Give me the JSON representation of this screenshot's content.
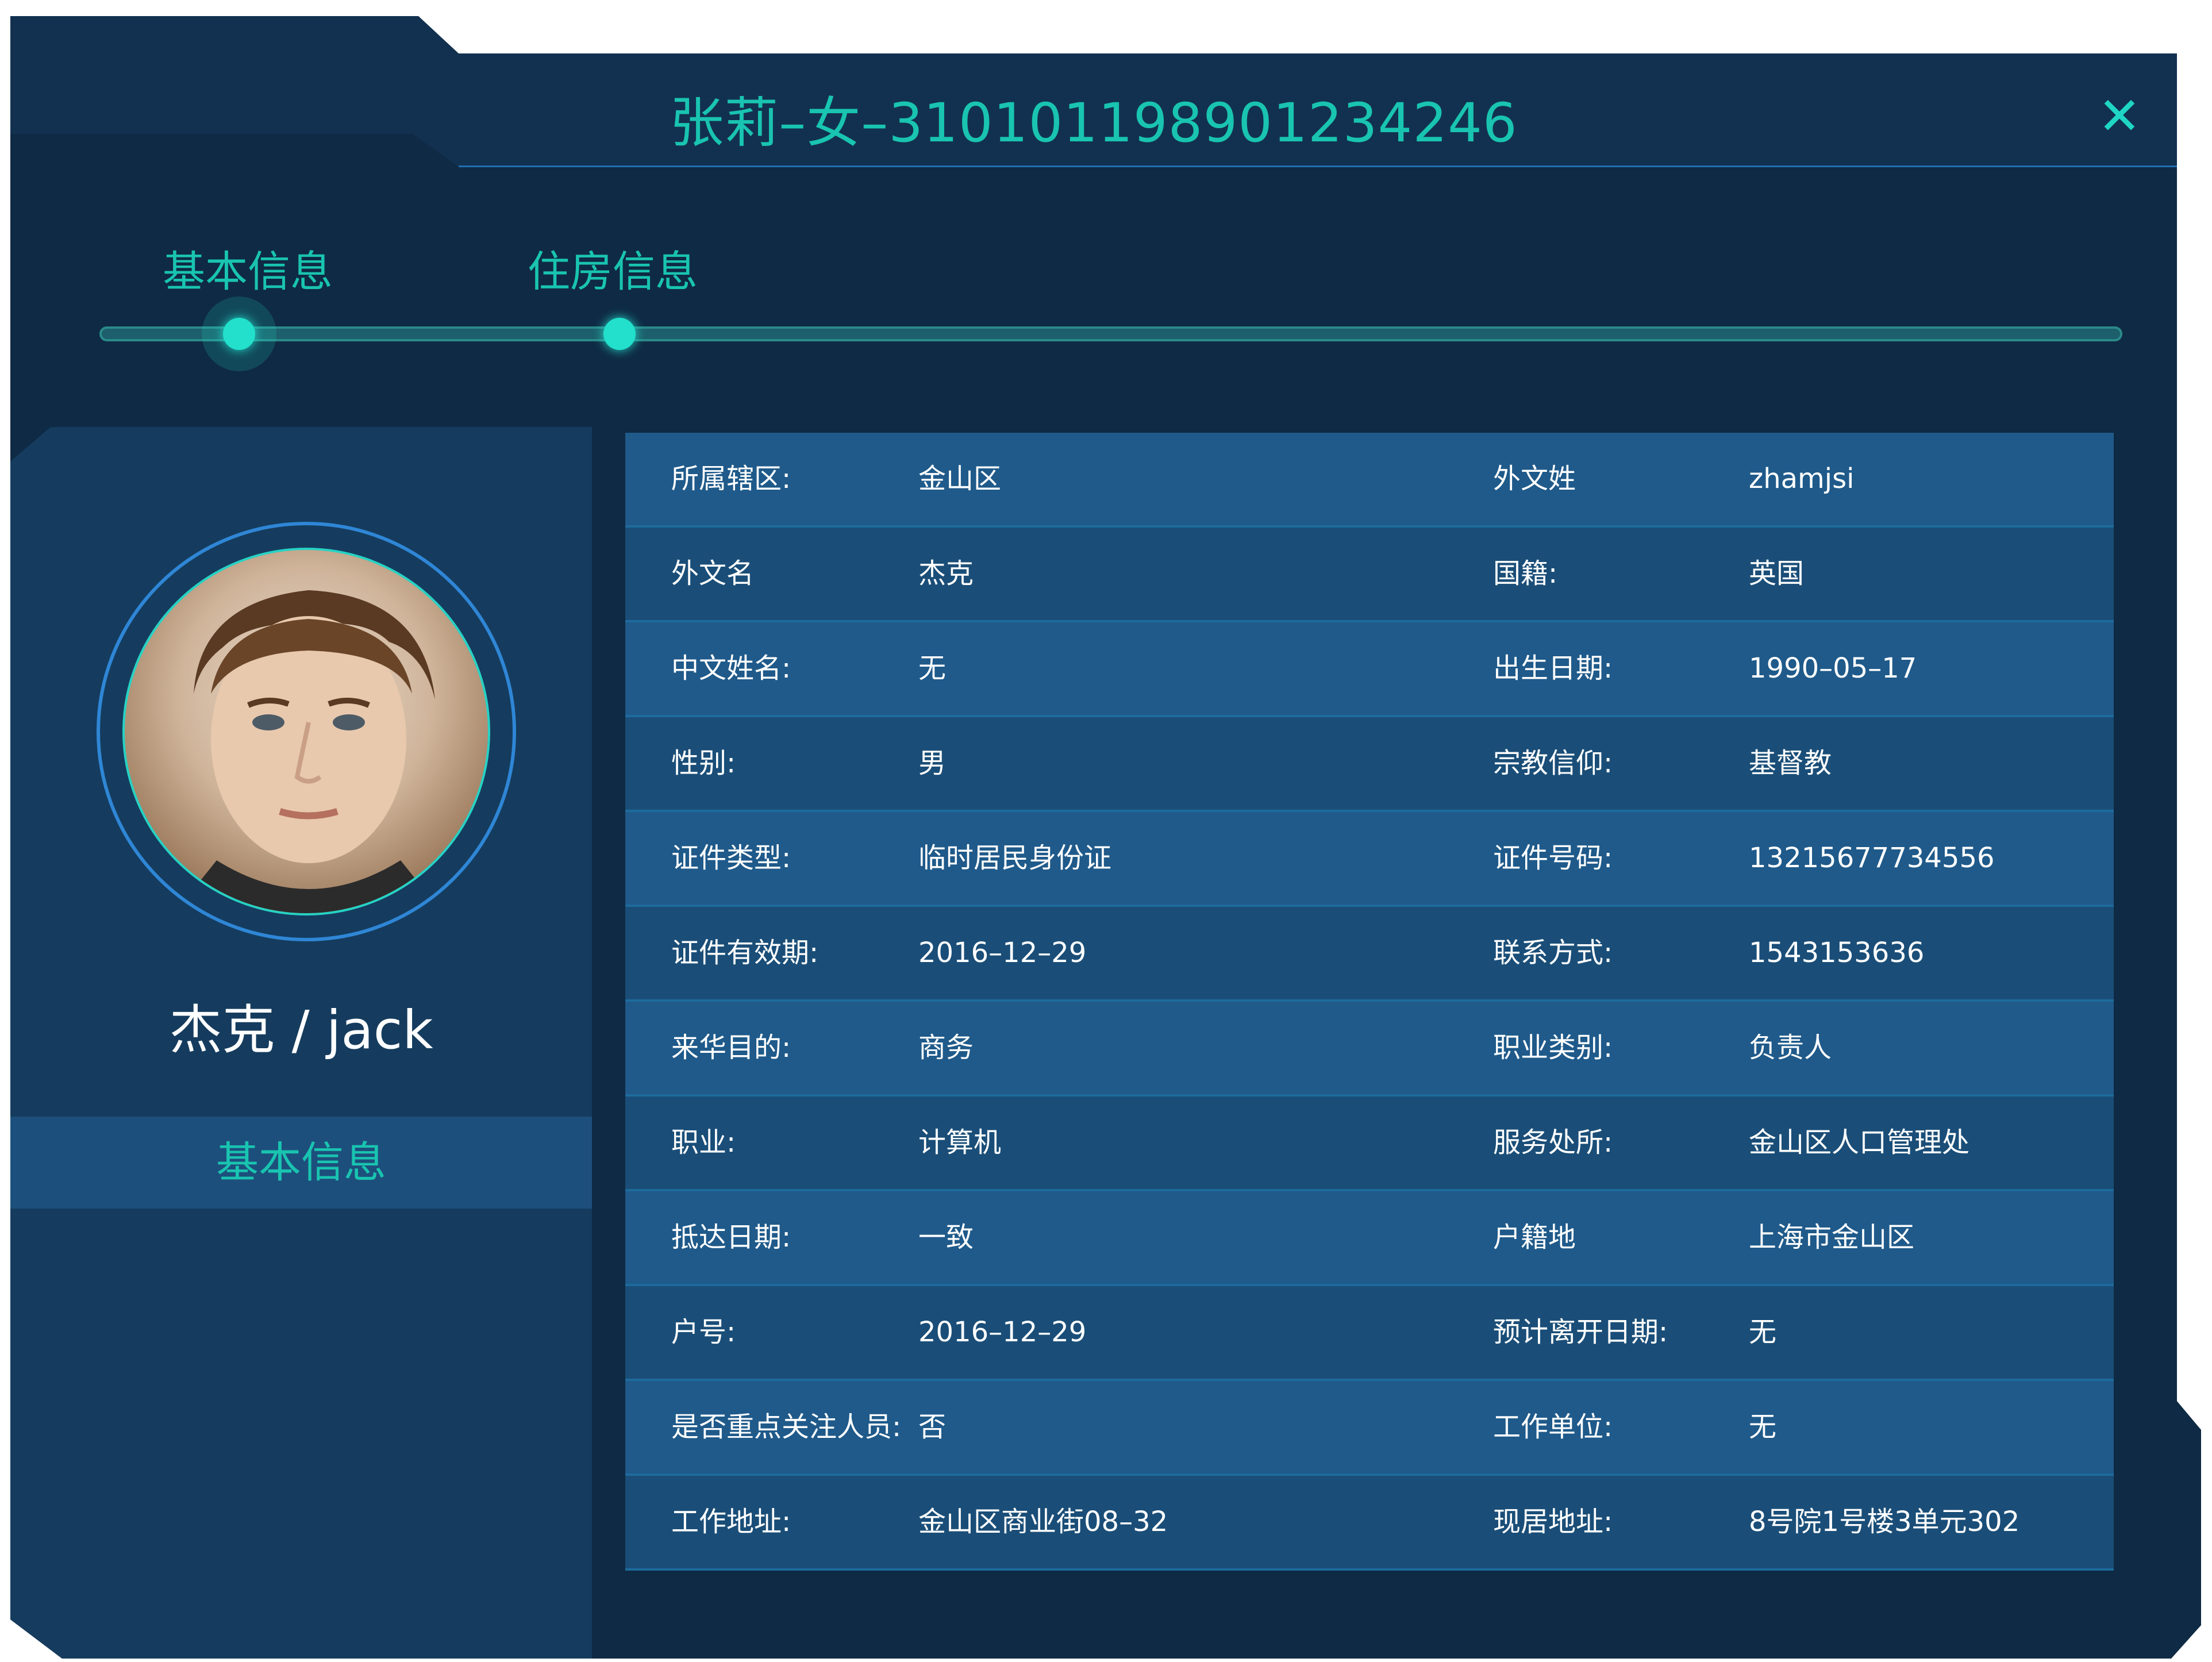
{
  "dialog": {
    "title": "张莉–女–310101198901234246"
  },
  "tabs": [
    {
      "label": "基本信息"
    },
    {
      "label": "住房信息"
    }
  ],
  "profile": {
    "name": "杰克 / jack",
    "section_tab": "基本信息"
  },
  "details": [
    {
      "label1": "所属辖区:",
      "value1": "金山区",
      "label2": "外文姓",
      "value2": "zhamjsi"
    },
    {
      "label1": "外文名",
      "value1": "杰克",
      "label2": "国籍:",
      "value2": "英国"
    },
    {
      "label1": "中文姓名:",
      "value1": "无",
      "label2": "出生日期:",
      "value2": "1990–05–17"
    },
    {
      "label1": "性别:",
      "value1": "男",
      "label2": "宗教信仰:",
      "value2": "基督教"
    },
    {
      "label1": "证件类型:",
      "value1": "临时居民身份证",
      "label2": "证件号码:",
      "value2": "13215677734556"
    },
    {
      "label1": "证件有效期:",
      "value1": "2016–12–29",
      "label2": "联系方式:",
      "value2": "1543153636"
    },
    {
      "label1": "来华目的:",
      "value1": "商务",
      "label2": "职业类别:",
      "value2": "负责人"
    },
    {
      "label1": "职业:",
      "value1": "计算机",
      "label2": "服务处所:",
      "value2": "金山区人口管理处"
    },
    {
      "label1": "抵达日期:",
      "value1": "一致",
      "label2": "户籍地",
      "value2": "上海市金山区"
    },
    {
      "label1": "户号:",
      "value1": "2016–12–29",
      "label2": "预计离开日期:",
      "value2": "无"
    },
    {
      "label1": "是否重点关注人员:",
      "value1": "否",
      "label2": "工作单位:",
      "value2": "无"
    },
    {
      "label1": "工作地址:",
      "value1": "金山区商业街08–32",
      "label2": "现居地址:",
      "value2": "8号院1号楼3单元302"
    }
  ]
}
